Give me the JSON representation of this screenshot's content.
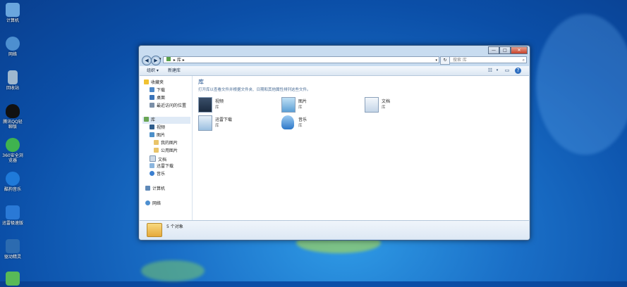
{
  "desktop": {
    "icons": [
      {
        "label": "计算机",
        "color": "#6aa6de"
      },
      {
        "label": "网络",
        "color": "#4d8fd0"
      },
      {
        "label": "回收站",
        "color": "#9fb8cf"
      },
      {
        "label": "腾讯QQ轻聊版",
        "color": "#111111"
      },
      {
        "label": "360安全浏览器",
        "color": "#3fb34f"
      },
      {
        "label": "酷狗音乐",
        "color": "#1f7ad9"
      },
      {
        "label": "迅雷极速版",
        "color": "#2a79d6"
      },
      {
        "label": "驱动精灵",
        "color": "#2c6bb0"
      },
      {
        "label": "",
        "color": "#58b957"
      }
    ]
  },
  "window": {
    "caption_buttons": {
      "minimize": "—",
      "maximize": "□",
      "close": "✕"
    },
    "nav": {
      "back": "◀",
      "forward": "▶",
      "dropdown": "▾"
    },
    "address": {
      "crumbs": [
        "▸",
        "库",
        "▸"
      ],
      "dropdown": "▾"
    },
    "refresh": "↻",
    "search": {
      "placeholder": "搜索 库",
      "icon": "search-icon"
    },
    "toolbar": {
      "organize": "组织 ▾",
      "new_library": "新建库",
      "view_icon": "☷",
      "view_dropdown": "▾",
      "pane_icon": "▭",
      "help_icon": "?"
    },
    "sidebar": {
      "favorites": {
        "label": "收藏夹",
        "items": [
          "下载",
          "桌面",
          "最近访问的位置"
        ]
      },
      "libraries": {
        "label": "库",
        "items": [
          "视频",
          "图片",
          "我的图片",
          "公用图片",
          "文档",
          "迅雷下载",
          "音乐"
        ]
      },
      "computer": {
        "label": "计算机"
      },
      "network": {
        "label": "网络"
      }
    },
    "content": {
      "title": "库",
      "subtitle": "打开库以查看文件并根据文件夹、日期和其他属性排列这些文件。",
      "libraries": [
        {
          "name": "视频",
          "type": "库"
        },
        {
          "name": "图片",
          "type": "库"
        },
        {
          "name": "文档",
          "type": "库"
        },
        {
          "name": "迅雷下载",
          "type": "库"
        },
        {
          "name": "音乐",
          "type": "库"
        }
      ]
    },
    "details": {
      "count": "5 个对象"
    }
  }
}
